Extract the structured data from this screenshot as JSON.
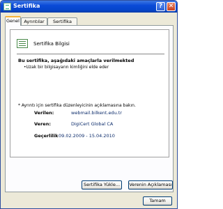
{
  "window": {
    "title": "Sertifika"
  },
  "tabs": [
    "Genel",
    "Ayrıntılar",
    "Sertifika Yolu"
  ],
  "info": {
    "title": "Sertifika Bilgisi",
    "purpose_heading": "Bu sertifika, aşağıdaki amaçlarla verilmekted",
    "purposes": [
      "•Uzak bir bilgisayarın kimliğini elde eder"
    ],
    "note": "* Ayrıntı için sertifika düzenleyicinin açıklamasına bakın.",
    "issued_to_label": "Verilen:",
    "issued_to_value": "webmail.bilkent.edu.tr",
    "issued_by_label": "Veren:",
    "issued_by_value": "DigiCert Global CA",
    "validity_label": "Geçerlilik",
    "validity_value": "09.02.2009  -  15.04.2010"
  },
  "buttons": {
    "install": "Sertifika Yükle...",
    "statement": "Verenin Açıklaması",
    "ok": "Tamam"
  },
  "icons": {
    "title": "certificate-icon",
    "info": "certificate-icon",
    "help": "help-icon",
    "close": "close-icon"
  },
  "colors": {
    "titlebar": "#0a4ad8",
    "close": "#c7401d",
    "tab_accent": "#f6b33a"
  }
}
